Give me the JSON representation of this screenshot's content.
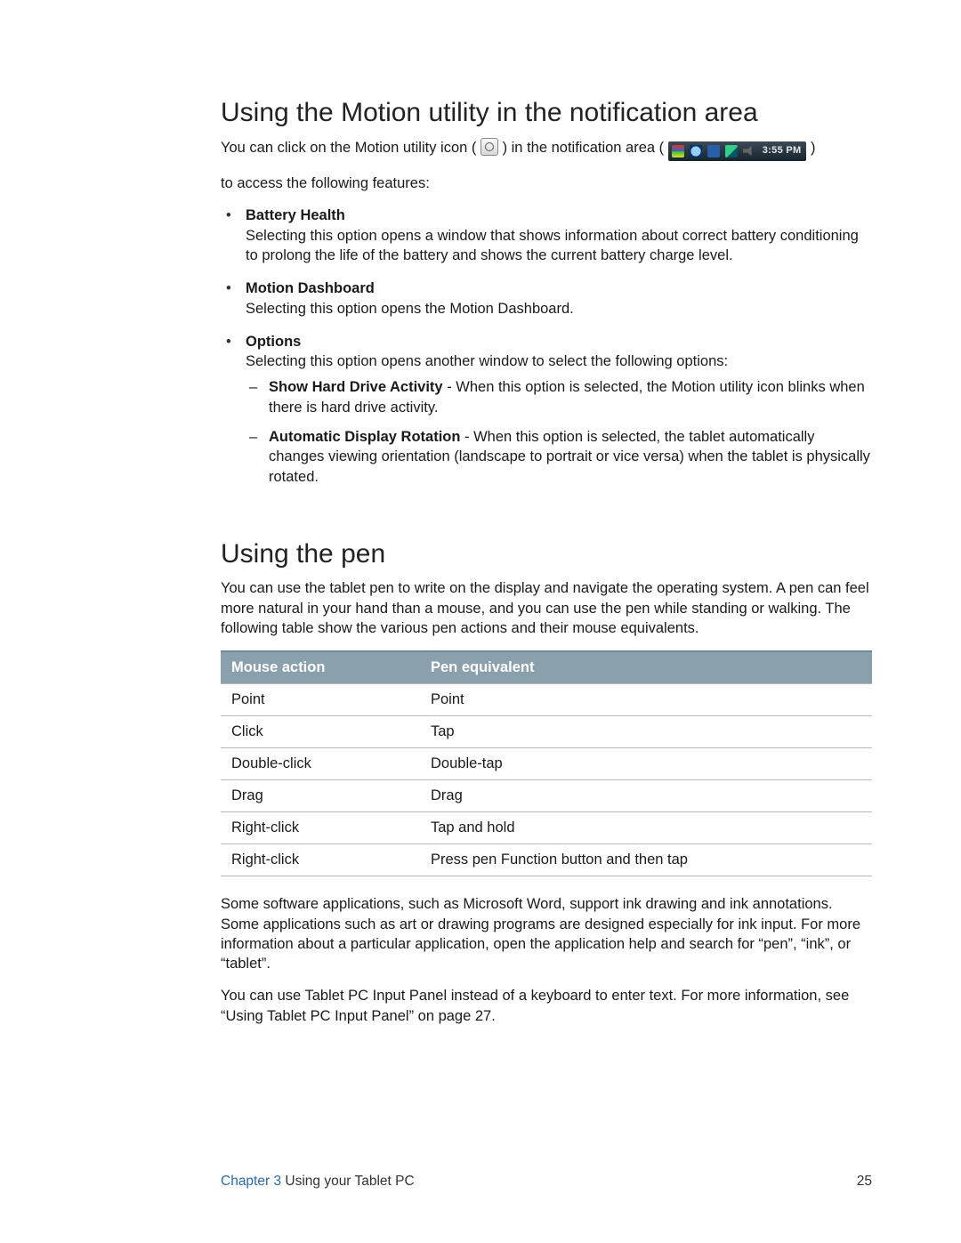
{
  "section1": {
    "heading": "Using the Motion utility in the notification area",
    "intro_before_icon": "You can click on the Motion utility icon (",
    "intro_between": ") in the notification area (",
    "intro_after_tray": ")",
    "tray_time": "3:55 PM",
    "intro_line2": "to access the following features:",
    "bullets": [
      {
        "title": "Battery Health",
        "desc": "Selecting this option opens a window that shows information about correct battery conditioning to prolong the life of the battery and shows the current battery charge level."
      },
      {
        "title": "Motion Dashboard",
        "desc": "Selecting this option opens the Motion Dashboard."
      },
      {
        "title": "Options",
        "desc": "Selecting this option opens another window to select the following options:",
        "sub": [
          {
            "title": "Show Hard Drive Activity",
            "desc": " - When this option is selected, the Motion utility icon blinks when there is hard drive activity."
          },
          {
            "title": "Automatic Display Rotation",
            "desc": " - When this option is selected, the tablet automatically changes viewing orientation (landscape to portrait or vice versa) when the tablet is physically rotated."
          }
        ]
      }
    ]
  },
  "section2": {
    "heading": "Using the pen",
    "intro": "You can use the tablet pen to write on the display and navigate the operating system. A pen can feel more natural in your hand than a mouse, and you can use the pen while standing or walking. The following table show the various pen actions and their mouse equivalents.",
    "table": {
      "headers": [
        "Mouse action",
        "Pen equivalent"
      ],
      "rows": [
        [
          "Point",
          "Point"
        ],
        [
          "Click",
          "Tap"
        ],
        [
          "Double-click",
          "Double-tap"
        ],
        [
          "Drag",
          "Drag"
        ],
        [
          "Right-click",
          "Tap and hold"
        ],
        [
          "Right-click",
          "Press pen Function button and then tap"
        ]
      ]
    },
    "p2": "Some software applications, such as Microsoft Word, support ink drawing and ink annotations. Some applications such as art or drawing programs are designed especially for ink input. For more information about a particular application, open the application help and search for “pen”, “ink”, or “tablet”.",
    "p3": "You can use Tablet PC Input Panel instead of a keyboard to enter text. For more information, see “Using Tablet PC Input Panel” on page 27."
  },
  "footer": {
    "chapter_label": "Chapter 3",
    "chapter_title": "  Using your Tablet PC",
    "page_number": "25"
  }
}
